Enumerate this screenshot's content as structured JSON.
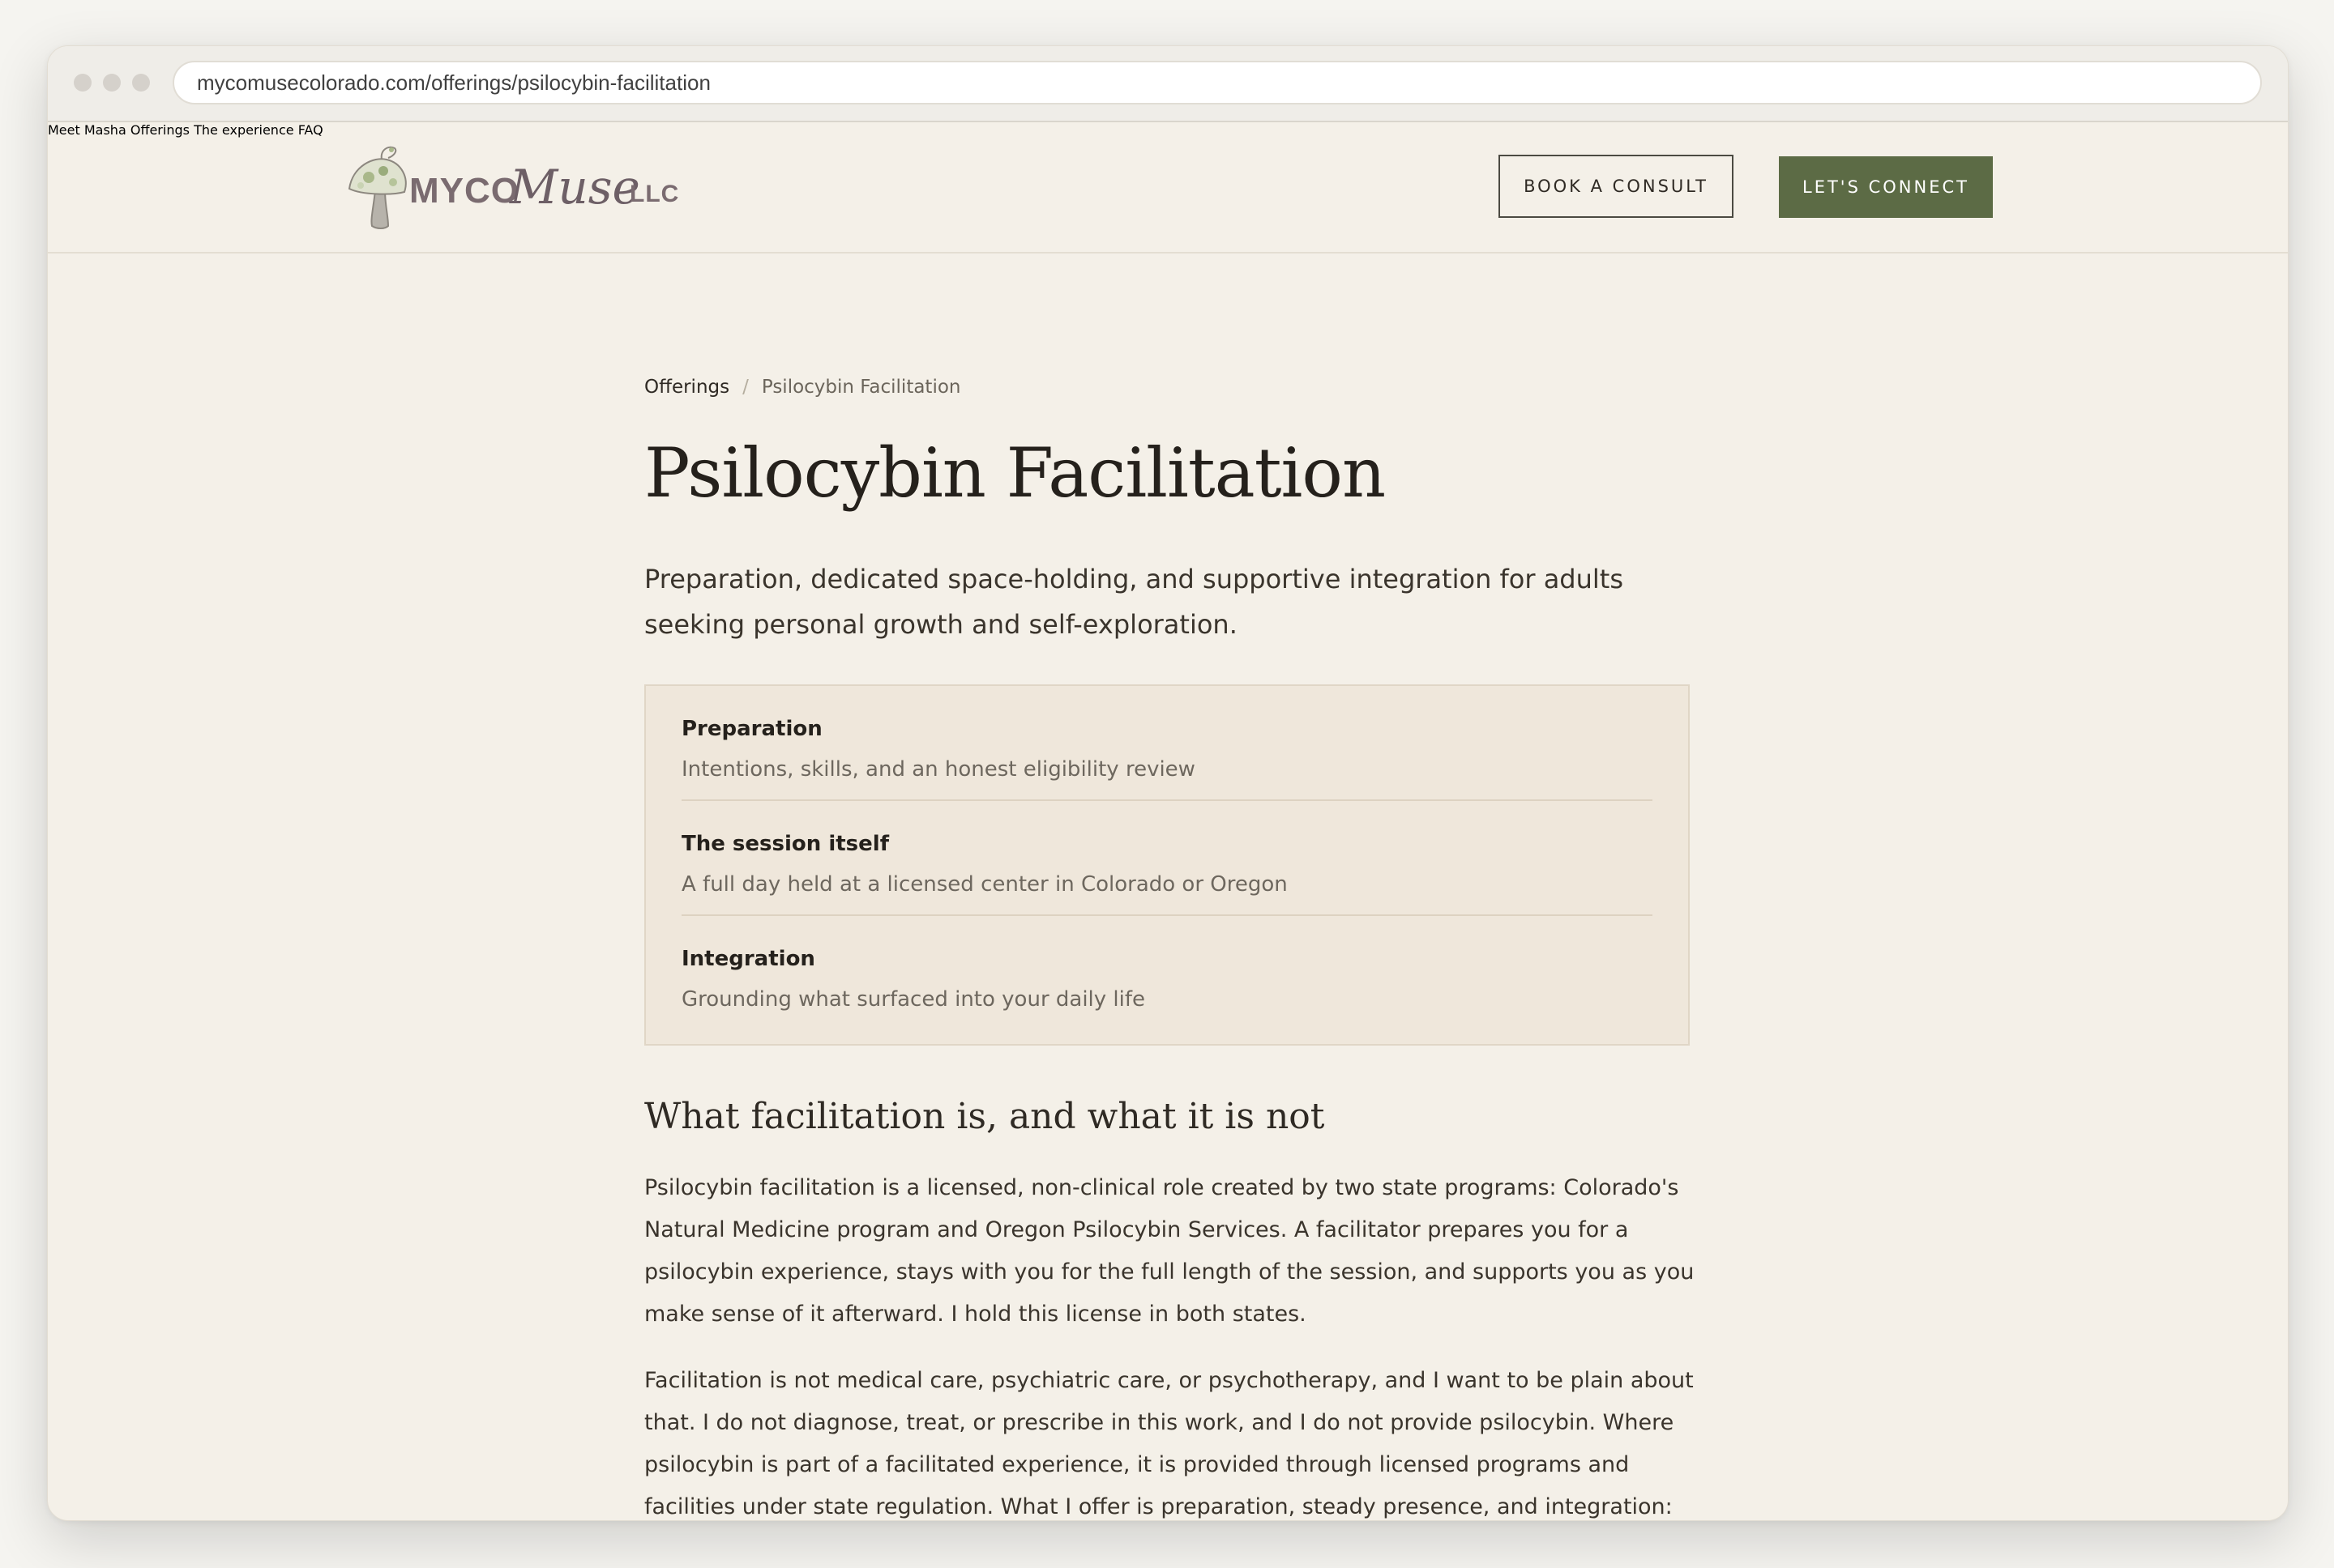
{
  "browser": {
    "url": "mycomusecolorado.com/offerings/psilocybin-facilitation"
  },
  "header": {
    "logo": {
      "myco": "MYCO",
      "muse": "Muse",
      "llc": "LLC"
    },
    "nav": [
      {
        "label": "Meet Masha"
      },
      {
        "label": "Offerings"
      },
      {
        "label": "The experience"
      },
      {
        "label": "FAQ"
      }
    ],
    "book_consult_label": "BOOK A CONSULT",
    "connect_label": "LET'S CONNECT",
    "accent_color": "#5c6b45"
  },
  "breadcrumb": {
    "parent": "Offerings",
    "separator": "/",
    "current": "Psilocybin Facilitation"
  },
  "page": {
    "title": "Psilocybin Facilitation",
    "lede": "Preparation, dedicated space-holding, and supportive integration for adults seeking personal growth and self-exploration."
  },
  "steps": [
    {
      "title": "Preparation",
      "subtitle": "Intentions, skills, and an honest eligibility review"
    },
    {
      "title": "The session itself",
      "subtitle": "A full day held at a licensed center in Colorado or Oregon"
    },
    {
      "title": "Integration",
      "subtitle": "Grounding what surfaced into your daily life"
    }
  ],
  "section": {
    "heading": "What facilitation is, and what it is not",
    "paragraphs": [
      "Psilocybin facilitation is a licensed, non-clinical role created by two state programs: Colorado's Natural Medicine program and Oregon Psilocybin Services. A facilitator prepares you for a psilocybin experience, stays with you for the full length of the session, and supports you as you make sense of it afterward. I hold this license in both states.",
      "Facilitation is not medical care, psychiatric care, or psychotherapy, and I want to be plain about that. I do not diagnose, treat, or prescribe in this work, and I do not provide psilocybin. Where psilocybin is part of a facilitated experience, it is provided through licensed programs and facilities under state regulation. What I offer is preparation, steady presence, and integration: the human structure around the experience."
    ]
  }
}
